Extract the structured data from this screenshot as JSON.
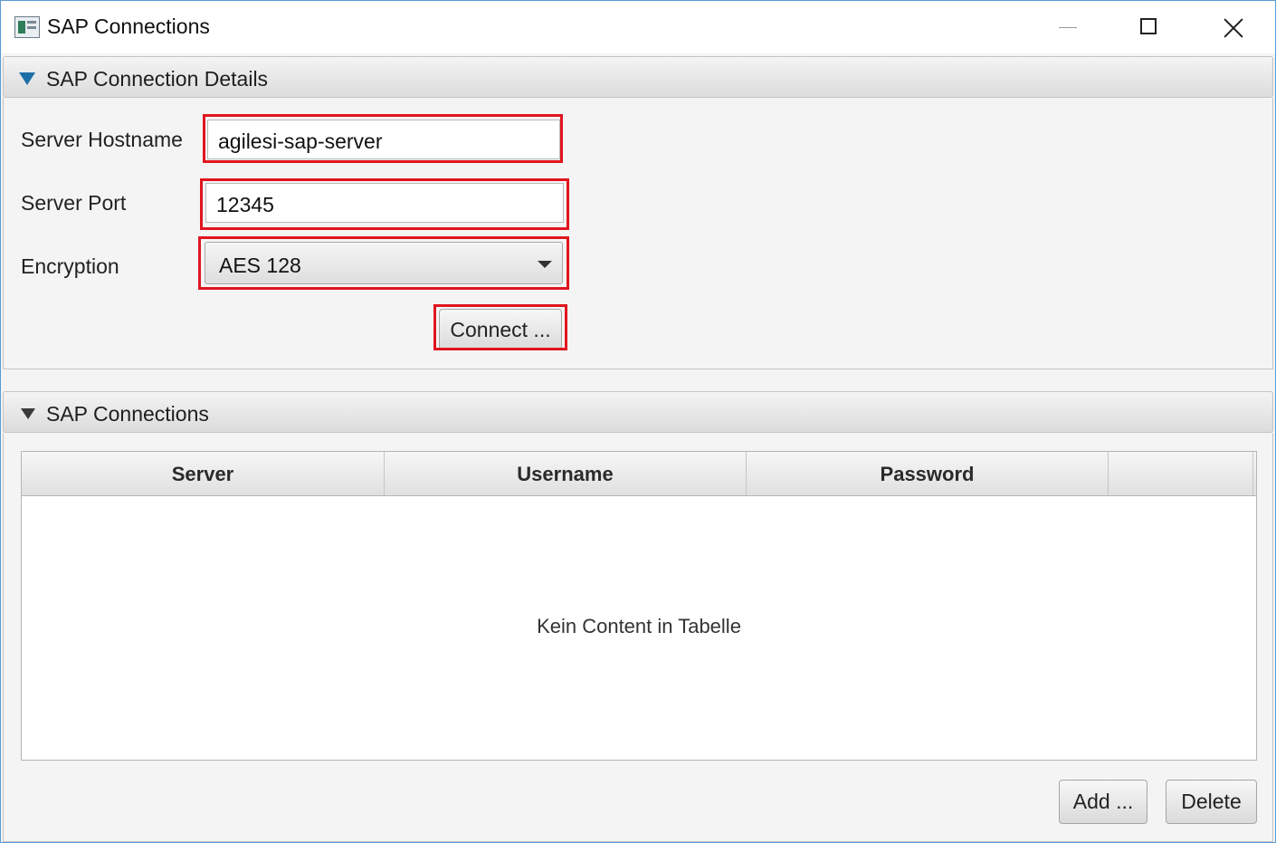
{
  "window": {
    "title": "SAP Connections",
    "controls": {
      "minimize": "minimize",
      "maximize": "maximize",
      "close": "close"
    }
  },
  "details_pane": {
    "title": "SAP Connection Details",
    "expanded": true,
    "hostname_label": "Server Hostname",
    "hostname_value": "agilesi-sap-server",
    "port_label": "Server Port",
    "port_value": "12345",
    "encryption_label": "Encryption",
    "encryption_value": "AES 128",
    "connect_label": "Connect ..."
  },
  "connections_pane": {
    "title": "SAP Connections",
    "expanded": true,
    "table": {
      "columns": [
        "Server",
        "Username",
        "Password",
        ""
      ],
      "rows": [],
      "placeholder": "Kein Content in Tabelle"
    },
    "add_label": "Add ...",
    "delete_label": "Delete"
  },
  "colors": {
    "highlight": "#e0151f",
    "window_border": "#5b9bd5",
    "expand_arrow": "#1c6fa6"
  },
  "icons": {
    "app": "java-app-icon",
    "minimize": "minimize-icon",
    "maximize": "maximize-icon",
    "close": "close-icon",
    "expand": "triangle-down-icon",
    "dropdown": "chevron-down-icon"
  }
}
